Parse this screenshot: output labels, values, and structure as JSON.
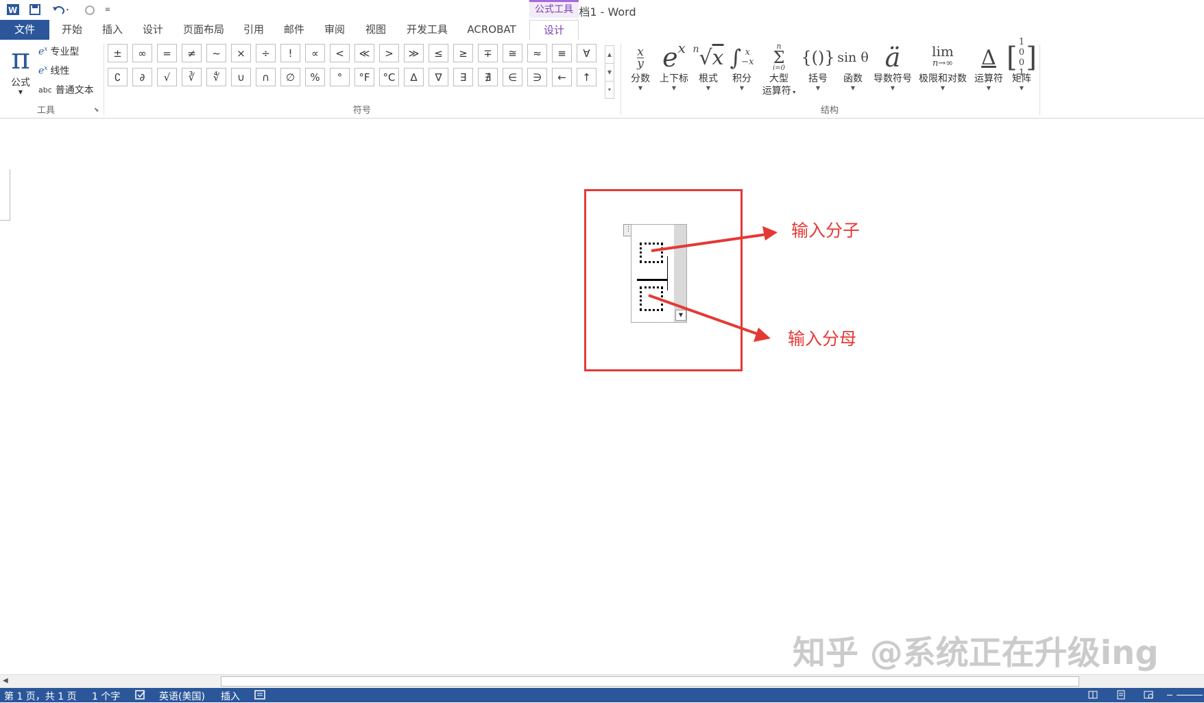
{
  "title_bar": {
    "doc_title": "文档1 - Word",
    "context_tab_group": "公式工具",
    "qat_more": "≡"
  },
  "tabs": [
    {
      "label": "文件"
    },
    {
      "label": "开始"
    },
    {
      "label": "插入"
    },
    {
      "label": "设计"
    },
    {
      "label": "页面布局"
    },
    {
      "label": "引用"
    },
    {
      "label": "邮件"
    },
    {
      "label": "审阅"
    },
    {
      "label": "视图"
    },
    {
      "label": "开发工具"
    },
    {
      "label": "ACROBAT"
    },
    {
      "label": "设计"
    }
  ],
  "tools_group": {
    "label": "工具",
    "equation_label": "公式",
    "items": [
      {
        "label": "专业型"
      },
      {
        "label": "线性"
      },
      {
        "label": "普通文本",
        "prefix": "abc"
      }
    ]
  },
  "symbols_group": {
    "label": "符号",
    "row1": [
      "±",
      "∞",
      "=",
      "≠",
      "~",
      "×",
      "÷",
      "!",
      "∝",
      "<",
      "≪",
      ">",
      "≫",
      "≤",
      "≥",
      "∓",
      "≅",
      "≈",
      "≡",
      "∀"
    ],
    "row2": [
      "∁",
      "∂",
      "√",
      "∛",
      "∜",
      "∪",
      "∩",
      "∅",
      "%",
      "°",
      "°F",
      "°C",
      "∆",
      "∇",
      "∃",
      "∄",
      "∈",
      "∋",
      "←",
      "↑"
    ]
  },
  "structures_group": {
    "label": "结构",
    "items": [
      {
        "label": "分数",
        "glyph": "x/y"
      },
      {
        "label": "上下标",
        "glyph": "eˣ"
      },
      {
        "label": "根式",
        "glyph": "ⁿ√x"
      },
      {
        "label": "积分",
        "glyph": "∫"
      },
      {
        "label": "大型",
        "label2": "运算符",
        "glyph": "Σ"
      },
      {
        "label": "括号",
        "glyph": "{()}"
      },
      {
        "label": "函数",
        "glyph": "sin θ"
      },
      {
        "label": "导数符号",
        "glyph": "ä"
      },
      {
        "label": "极限和对数",
        "glyph": "lim"
      },
      {
        "label": "运算符",
        "glyph": "≜"
      },
      {
        "label": "矩阵",
        "glyph": "[10 01]"
      }
    ]
  },
  "annotations": {
    "numerator": "输入分子",
    "denominator": "输入分母",
    "watermark": "知乎 @系统正在升级ing"
  },
  "status_bar": {
    "page": "第 1 页，共 1 页",
    "words": "1 个字",
    "language": "英语(美国)",
    "mode": "插入"
  },
  "colors": {
    "word_blue": "#2b579a",
    "accent_purple": "#7a3fb5",
    "annotation_red": "#e53935"
  }
}
